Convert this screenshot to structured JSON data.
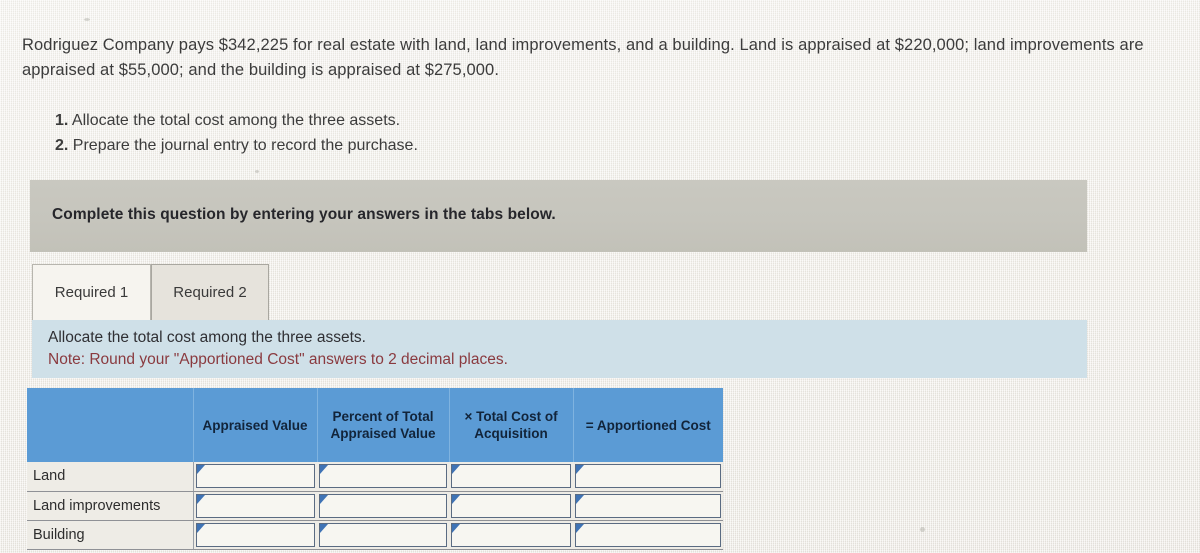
{
  "problem": {
    "statement": "Rodriguez Company pays $342,225 for real estate with land, land improvements, and a building. Land is appraised at $220,000; land improvements are appraised at $55,000; and the building is appraised at $275,000.",
    "requirements": [
      {
        "num": "1.",
        "text": "Allocate the total cost among the three assets."
      },
      {
        "num": "2.",
        "text": "Prepare the journal entry to record the purchase."
      }
    ]
  },
  "banner": {
    "text": "Complete this question by entering your answers in the tabs below."
  },
  "tabs": [
    {
      "label": "Required 1",
      "active": true
    },
    {
      "label": "Required 2",
      "active": false
    }
  ],
  "note": {
    "line1": "Allocate the total cost among the three assets.",
    "line2": "Note: Round your \"Apportioned Cost\" answers to 2 decimal places."
  },
  "table": {
    "headers": [
      "",
      "Appraised Value",
      "Percent of Total Appraised Value",
      "× Total Cost of Acquisition",
      "= Apportioned Cost"
    ],
    "rows": [
      {
        "label": "Land",
        "cells": [
          "",
          "",
          "",
          ""
        ]
      },
      {
        "label": "Land improvements",
        "cells": [
          "",
          "",
          "",
          ""
        ]
      },
      {
        "label": "Building",
        "cells": [
          "",
          "",
          "",
          ""
        ]
      }
    ]
  },
  "colors": {
    "header_blue": "#5b9bd5",
    "note_bar_blue": "#cfe0e8",
    "banner_gray": "#c6c5bd",
    "note_red": "#8a3a3f",
    "flag_blue": "#3f73b5",
    "page_bg": "#edebe5"
  }
}
